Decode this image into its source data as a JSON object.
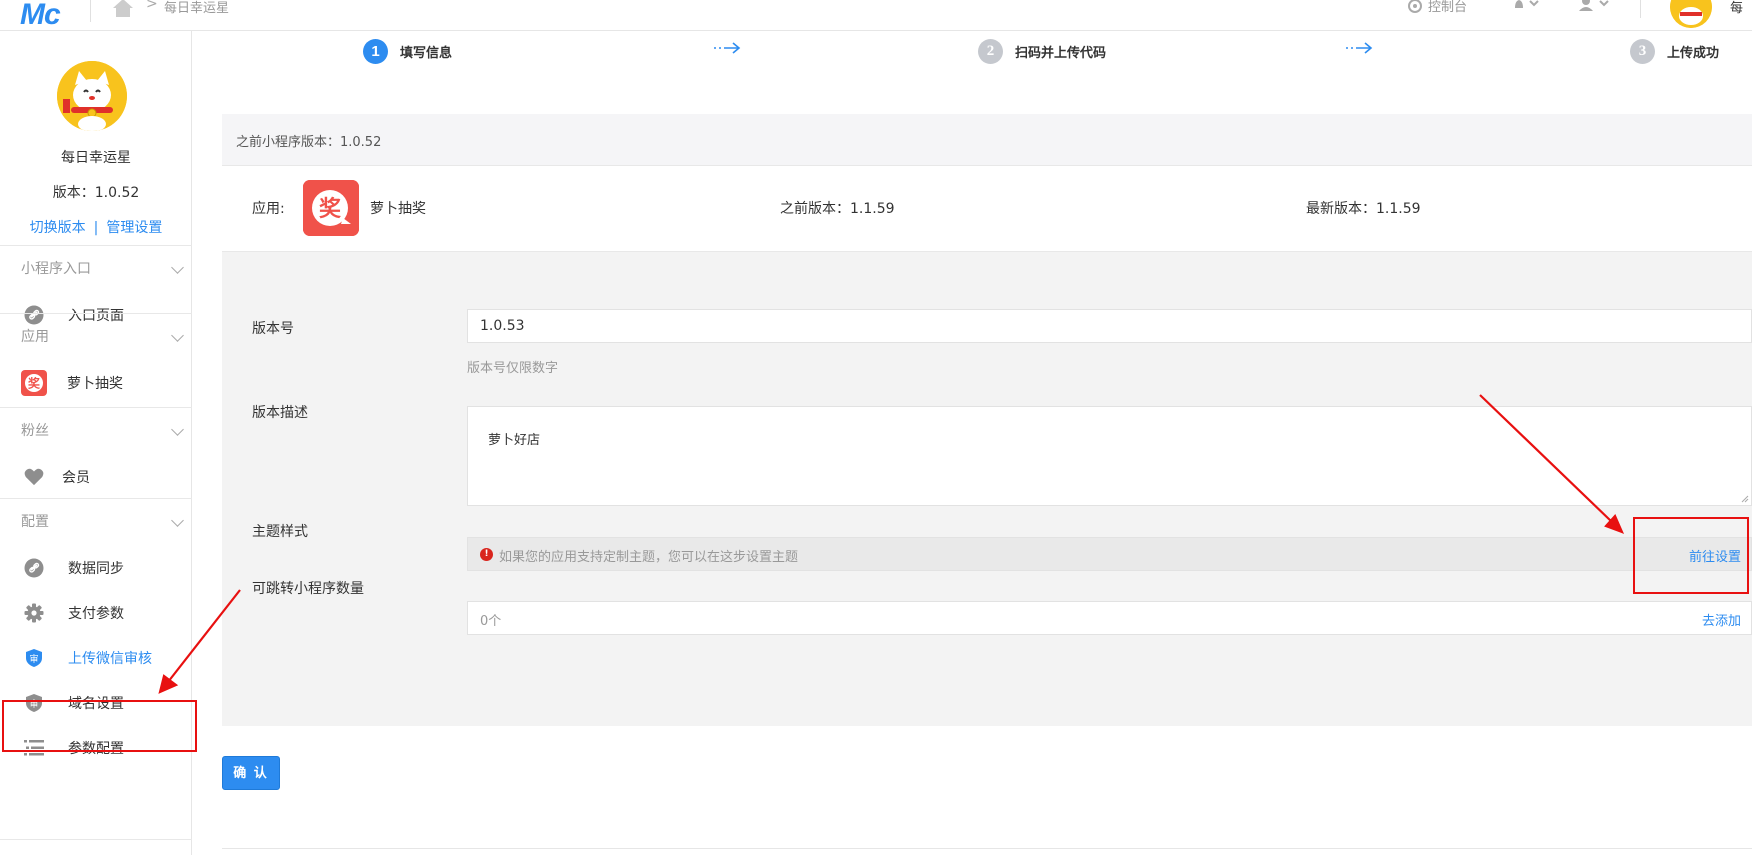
{
  "topbar": {
    "logo": "Mc",
    "breadcrumb": "每日幸运星",
    "console": "控制台",
    "user_name": "每"
  },
  "sidebar": {
    "app_name": "每日幸运星",
    "version": "版本：1.0.52",
    "switch_version": "切换版本",
    "separator": "|",
    "manage_settings": "管理设置",
    "groups": [
      {
        "title": "小程序入口",
        "items": [
          {
            "label": "入口页面",
            "icon": "link-icon"
          }
        ]
      },
      {
        "title": "应用",
        "items": [
          {
            "label": "萝卜抽奖",
            "icon": "prize-app-icon"
          }
        ]
      },
      {
        "title": "粉丝",
        "items": [
          {
            "label": "会员",
            "icon": "heart-icon"
          }
        ]
      },
      {
        "title": "配置",
        "items": [
          {
            "label": "数据同步",
            "icon": "link-icon"
          },
          {
            "label": "支付参数",
            "icon": "gear-icon"
          },
          {
            "label": "上传微信审核",
            "icon": "shield-icon",
            "active": true
          },
          {
            "label": "域名设置",
            "icon": "shield-icon"
          },
          {
            "label": "参数配置",
            "icon": "list-icon"
          }
        ]
      }
    ]
  },
  "steps": [
    {
      "num": "1",
      "label": "填写信息",
      "current": true
    },
    {
      "num": "2",
      "label": "扫码并上传代码",
      "current": false
    },
    {
      "num": "3",
      "label": "上传成功",
      "current": false
    }
  ],
  "main": {
    "prev_miniprogram_version": "之前小程序版本：1.0.52",
    "app_label": "应用:",
    "app_icon_glyph": "奖",
    "app_name": "萝卜抽奖",
    "app_prev_version": "之前版本：1.1.59",
    "app_latest_version": "最新版本：1.1.59",
    "form": {
      "version_label": "版本号",
      "version_value": "1.0.53",
      "version_hint": "版本号仅限数字",
      "desc_label": "版本描述",
      "desc_value": "萝卜好店",
      "theme_label": "主题样式",
      "theme_tip": "如果您的应用支持定制主题，您可以在这步设置主题",
      "theme_link": "前往设置",
      "jump_label": "可跳转小程序数量",
      "jump_value": "0个",
      "jump_link": "去添加"
    },
    "confirm": "确 认"
  },
  "colors": {
    "accent": "#2d8cf0",
    "annotation": "#e81010",
    "step_inactive": "#c5c8ce",
    "app_icon_bg": "#f0524a"
  }
}
